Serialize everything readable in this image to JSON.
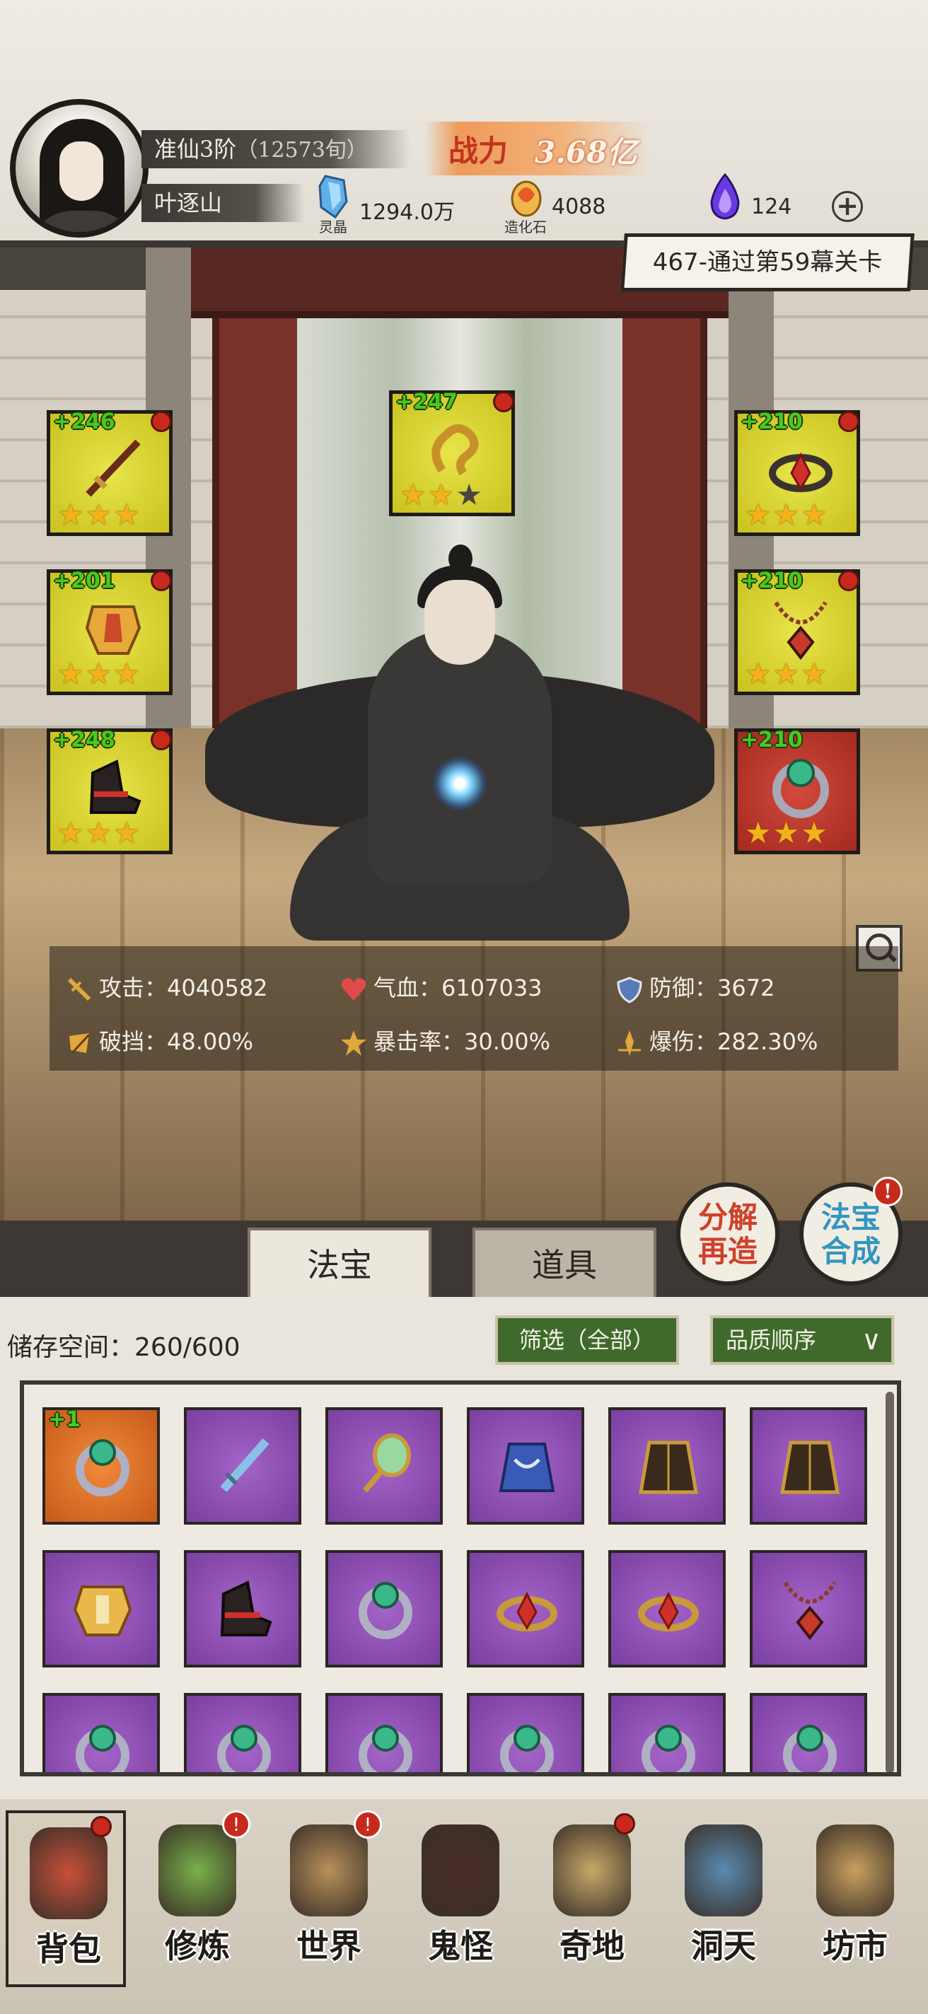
{
  "header": {
    "realm": "准仙3阶",
    "realm_progress": "（12573旬）",
    "player_name": "叶逐山",
    "power_label": "战力",
    "power_value": "3.68亿",
    "resources": [
      {
        "icon": "spirit-crystal-icon",
        "caption": "灵晶",
        "value": "1294.0万"
      },
      {
        "icon": "creation-stone-icon",
        "caption": "造化石",
        "value": "4088"
      },
      {
        "icon": "purple-flame-icon",
        "caption": "",
        "value": "124"
      }
    ],
    "add_button": "+",
    "quest": "467-通过第59幕关卡"
  },
  "equipment": {
    "left": [
      {
        "level": "+246",
        "stars": 3,
        "max_stars": 3,
        "quality": "yellow",
        "item": "sword"
      },
      {
        "level": "+201",
        "stars": 3,
        "max_stars": 3,
        "quality": "yellow",
        "item": "armor"
      },
      {
        "level": "+248",
        "stars": 3,
        "max_stars": 3,
        "quality": "yellow",
        "item": "boots"
      }
    ],
    "center": {
      "level": "+247",
      "stars": 2,
      "max_stars": 3,
      "quality": "yellow",
      "item": "talisman"
    },
    "right": [
      {
        "level": "+210",
        "stars": 3,
        "max_stars": 3,
        "quality": "yellow",
        "item": "crown"
      },
      {
        "level": "+210",
        "stars": 3,
        "max_stars": 3,
        "quality": "yellow",
        "item": "necklace"
      },
      {
        "level": "+210",
        "stars": 3,
        "max_stars": 3,
        "quality": "red",
        "item": "ring"
      }
    ]
  },
  "stats": [
    {
      "icon": "sword-icon",
      "label": "攻击：",
      "value": "4040582"
    },
    {
      "icon": "heart-icon",
      "label": "气血：",
      "value": "6107033"
    },
    {
      "icon": "shield-icon",
      "label": "防御：",
      "value": "3672"
    },
    {
      "icon": "break-icon",
      "label": "破挡：",
      "value": "48.00%"
    },
    {
      "icon": "crit-icon",
      "label": "暴击率：",
      "value": "30.00%"
    },
    {
      "icon": "crit-damage-icon",
      "label": "爆伤：",
      "value": "282.30%"
    }
  ],
  "tabs": [
    "法宝",
    "道具"
  ],
  "action_buttons": {
    "decompose": "分解再造",
    "compose": "法宝合成",
    "compose_badge": "!"
  },
  "storage": {
    "label": "储存空间：",
    "used": "260/600",
    "filter": "筛选（全部）",
    "sort": "品质顺序",
    "items": [
      {
        "item": "ring",
        "quality": "orange",
        "level": "+1"
      },
      {
        "item": "sword",
        "quality": "purple"
      },
      {
        "item": "mirror",
        "quality": "purple"
      },
      {
        "item": "robe",
        "quality": "purple"
      },
      {
        "item": "cloak",
        "quality": "purple"
      },
      {
        "item": "cloak",
        "quality": "purple"
      },
      {
        "item": "armor",
        "quality": "purple"
      },
      {
        "item": "boots",
        "quality": "purple"
      },
      {
        "item": "ring",
        "quality": "purple"
      },
      {
        "item": "crown",
        "quality": "purple"
      },
      {
        "item": "crown",
        "quality": "purple"
      },
      {
        "item": "necklace",
        "quality": "purple"
      },
      {
        "item": "ring",
        "quality": "purple"
      },
      {
        "item": "ring",
        "quality": "purple"
      },
      {
        "item": "ring",
        "quality": "purple"
      },
      {
        "item": "ring",
        "quality": "purple"
      },
      {
        "item": "ring",
        "quality": "purple"
      },
      {
        "item": "ring",
        "quality": "purple"
      }
    ]
  },
  "nav": [
    {
      "label": "背包",
      "icon": "backpack-icon",
      "active": true,
      "badge": "dot"
    },
    {
      "label": "修炼",
      "icon": "lotus-icon",
      "active": false,
      "badge": "!"
    },
    {
      "label": "世界",
      "icon": "scroll-map-icon",
      "active": false,
      "badge": "!"
    },
    {
      "label": "鬼怪",
      "icon": "demon-egg-icon",
      "active": false,
      "badge": ""
    },
    {
      "label": "奇地",
      "icon": "temple-icon",
      "active": false,
      "badge": "dot"
    },
    {
      "label": "洞天",
      "icon": "portal-icon",
      "active": false,
      "badge": ""
    },
    {
      "label": "坊市",
      "icon": "market-stall-icon",
      "active": false,
      "badge": ""
    }
  ],
  "colors": {
    "quality_yellow": "#d8d32f",
    "quality_red": "#b8352a",
    "quality_purple": "#8e4fb4",
    "quality_orange": "#e07a30",
    "level_green": "#4ac91d",
    "power_red": "#c0341f",
    "badge_red": "#c72a1c"
  }
}
